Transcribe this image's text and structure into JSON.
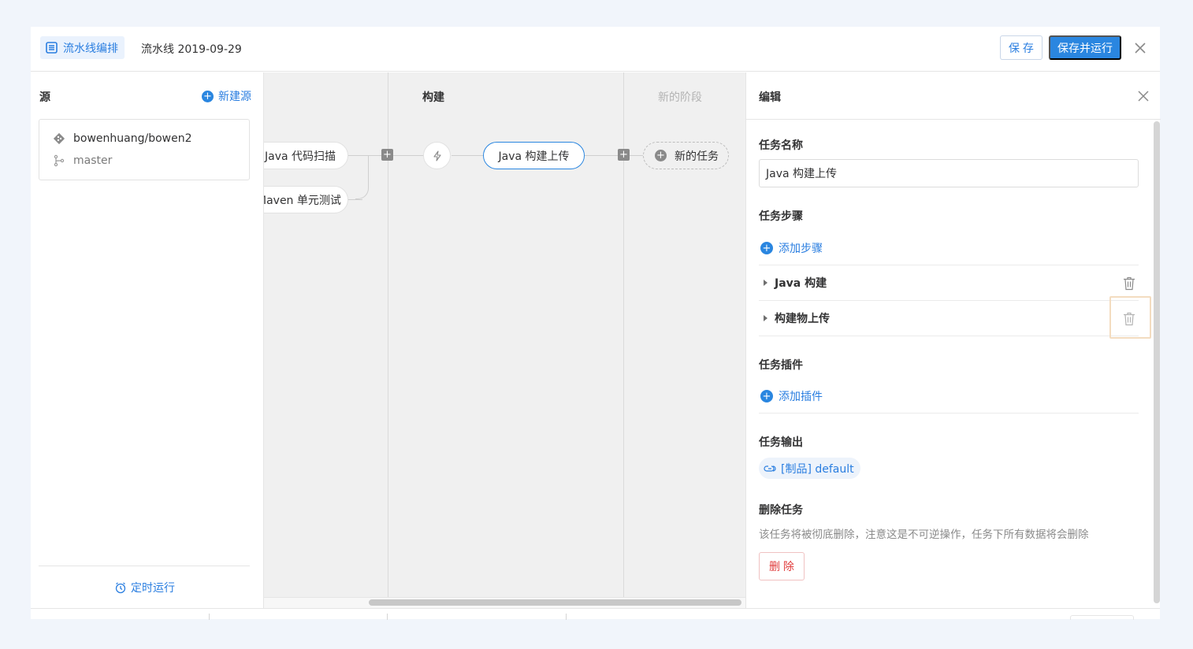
{
  "header": {
    "tag_label": "流水线编排",
    "pipeline_name": "流水线 2019-09-29",
    "save_label": "保 存",
    "save_run_label": "保存并运行"
  },
  "left_panel": {
    "title": "源",
    "new_source_label": "新建源",
    "source": {
      "repo": "bowenhuang/bowen2",
      "branch": "master"
    },
    "schedule_label": "定时运行"
  },
  "canvas": {
    "stages": [
      {
        "title": "构建"
      },
      {
        "title": "新的阶段"
      }
    ],
    "tasks": [
      {
        "label": "Java 代码扫描"
      },
      {
        "label": "Maven 单元测试"
      },
      {
        "label": "Java 构建上传"
      },
      {
        "label": "新的任务"
      }
    ]
  },
  "edit_panel": {
    "title": "编辑",
    "task_name_label": "任务名称",
    "task_name_value": "Java 构建上传",
    "steps_label": "任务步骤",
    "add_step_label": "添加步骤",
    "steps": [
      {
        "label": "Java 构建"
      },
      {
        "label": "构建物上传"
      }
    ],
    "plugins_label": "任务插件",
    "add_plugin_label": "添加插件",
    "output_label": "任务输出",
    "output_tag": "[制品] default",
    "delete_label": "删除任务",
    "delete_desc": "该任务将被彻底删除，注意这是不可逆操作，任务下所有数据将会删除",
    "delete_button": "删 除"
  },
  "colors": {
    "accent": "#2a86e0",
    "danger": "#e03b3b",
    "background": "#f1f5fb",
    "canvas": "#f0f0f0"
  }
}
